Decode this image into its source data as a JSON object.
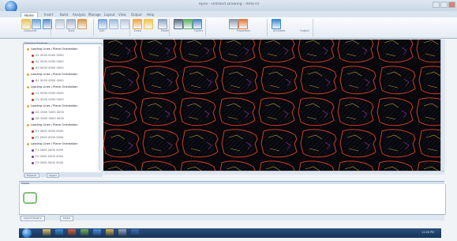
{
  "window": {
    "title": "Apex - Untitled Drawing - ARISTO",
    "tabs": [
      {
        "label": "Home",
        "active": true
      },
      {
        "label": "Insert",
        "active": false
      },
      {
        "label": "Build",
        "active": false
      },
      {
        "label": "Analysis",
        "active": false
      },
      {
        "label": "Manage",
        "active": false
      },
      {
        "label": "Layout",
        "active": false
      },
      {
        "label": "View",
        "active": false
      },
      {
        "label": "Output",
        "active": false
      },
      {
        "label": "Help",
        "active": false
      }
    ]
  },
  "ribbon": {
    "groups": [
      "Clipboard",
      "Tools",
      "Edit",
      "Draw",
      "Modify",
      "Layers",
      "Properties",
      "Annotate",
      "Output"
    ],
    "buttons": [
      {
        "name": "new-button",
        "color": "#e9c25a"
      },
      {
        "name": "open-button",
        "color": "#6aa1d8"
      },
      {
        "name": "save-button",
        "color": "#5c8fc9"
      },
      {
        "name": "cut-button",
        "color": "#b7c3d0"
      },
      {
        "name": "copy-button",
        "color": "#9fb0c4"
      },
      {
        "name": "paste-button",
        "color": "#d69a4c"
      },
      {
        "name": "select-button",
        "color": "#7ea6d6"
      },
      {
        "name": "zoom-button",
        "color": "#9bb8db"
      },
      {
        "name": "pan-button",
        "color": "#b6c6d8"
      },
      {
        "name": "layer-button",
        "color": "#f0a545"
      },
      {
        "name": "rectangle-button",
        "color": "#f2c24a"
      },
      {
        "name": "line-button",
        "color": "#8fa4bb"
      },
      {
        "name": "link-button",
        "color": "#5a6b82"
      },
      {
        "name": "export-button",
        "color": "#5fb35f"
      },
      {
        "name": "gear-button",
        "color": "#4d86c6"
      },
      {
        "name": "print-button",
        "color": "#8a9bb0"
      },
      {
        "name": "color-button",
        "color": "#e07b3e"
      },
      {
        "name": "help-button",
        "color": "#3a88cf"
      }
    ]
  },
  "tree": {
    "title": "Drawing Explorer",
    "nodes": [
      {
        "label": "Loading Lines / Plane Orientation",
        "icon_color": "#e6a52b",
        "child": false
      },
      {
        "label": "A1 0000 0000 0000",
        "icon_color": "#c0392b",
        "child": true
      },
      {
        "label": "A2 0000 0000 0000",
        "icon_color": "#c0392b",
        "child": true
      },
      {
        "label": "A3 0000 0000 0000",
        "icon_color": "#c0392b",
        "child": true
      },
      {
        "label": "Loading Lines / Plane Orientation",
        "icon_color": "#e6a52b",
        "child": false
      },
      {
        "label": "B1 0000 0000 0000",
        "icon_color": "#7d3c98",
        "child": true
      },
      {
        "label": "Loading Lines / Plane Orientation",
        "icon_color": "#e6a52b",
        "child": false
      },
      {
        "label": "C1 0000 0000 0000",
        "icon_color": "#c0392b",
        "child": true
      },
      {
        "label": "C2 0000 0000 0000",
        "icon_color": "#c0392b",
        "child": true
      },
      {
        "label": "Loading Lines / Plane Orientation",
        "icon_color": "#e6a52b",
        "child": false
      },
      {
        "label": "D1 0000 0000 0000",
        "icon_color": "#7d3c98",
        "child": true
      },
      {
        "label": "D2 0000 0000 0000",
        "icon_color": "#7d3c98",
        "child": true
      },
      {
        "label": "Loading Lines / Plane Orientation",
        "icon_color": "#e6a52b",
        "child": false
      },
      {
        "label": "E1 0000 0000 0000",
        "icon_color": "#c0392b",
        "child": true
      },
      {
        "label": "E2 0000 0000 0000",
        "icon_color": "#c0392b",
        "child": true
      },
      {
        "label": "Loading Lines / Plane Orientation",
        "icon_color": "#e6a52b",
        "child": false
      },
      {
        "label": "F1 0000 0000 0000",
        "icon_color": "#7d3c98",
        "child": true
      },
      {
        "label": "F2 0000 0000 0000",
        "icon_color": "#7d3c98",
        "child": true
      },
      {
        "label": "F3 0000 0000 0000",
        "icon_color": "#7d3c98",
        "child": true
      }
    ],
    "tabs": [
      "Explorer",
      "Layers"
    ]
  },
  "canvas": {
    "background": "#08070b",
    "outline_color": "#c8402a",
    "highlight_color": "#e8c24a",
    "hatch_color": "#3a5a8a"
  },
  "bottom": {
    "title": "Sheets",
    "tabs": [
      "Layout Sheet 1",
      "Model"
    ]
  },
  "taskbar": {
    "apps": [
      "#e9c25a",
      "#3b8fd8",
      "#e35d2f",
      "#6fb54a",
      "#4a90e2",
      "#d9b44a",
      "#9aa7b5",
      "#3a6fb0"
    ],
    "clock": "12:00 PM"
  }
}
